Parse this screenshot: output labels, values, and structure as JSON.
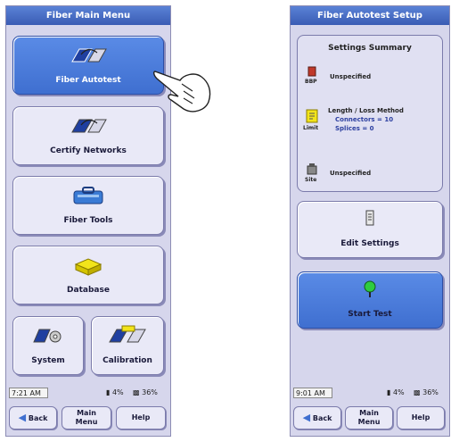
{
  "left": {
    "title": "Fiber Main Menu",
    "buttons": [
      {
        "label": "Fiber Autotest",
        "icon": "fiber-autotest-icon"
      },
      {
        "label": "Certify Networks",
        "icon": "certify-networks-icon"
      },
      {
        "label": "Fiber Tools",
        "icon": "toolbox-icon"
      },
      {
        "label": "Database",
        "icon": "database-icon"
      }
    ],
    "small_buttons": [
      {
        "label": "System",
        "icon": "system-icon"
      },
      {
        "label": "Calibration",
        "icon": "calibration-icon"
      }
    ],
    "status": {
      "time": "7:21 AM",
      "battery1": "4%",
      "battery2": "36%"
    },
    "bottom": {
      "back": "Back",
      "main_menu": "Main Menu",
      "help": "Help"
    }
  },
  "right": {
    "title": "Fiber Autotest Setup",
    "summary": {
      "title": "Settings Summary",
      "item1": "Unspecified",
      "item1_icon_label": "BBP",
      "item2_line1": "Length / Loss Method",
      "item2_line2": "Connectors = 10",
      "item2_line3": "Splices = 0",
      "item2_icon_label": "Limit",
      "item3": "Unspecified",
      "item3_icon_label": "Site"
    },
    "edit_settings": "Edit Settings",
    "start_test": "Start Test",
    "status": {
      "time": "9:01 AM",
      "battery1": "4%",
      "battery2": "36%"
    },
    "bottom": {
      "back": "Back",
      "main_menu": "Main Menu",
      "help": "Help"
    }
  },
  "colors": {
    "accent": "#3f6fd0",
    "panel": "#d6d6ec"
  }
}
